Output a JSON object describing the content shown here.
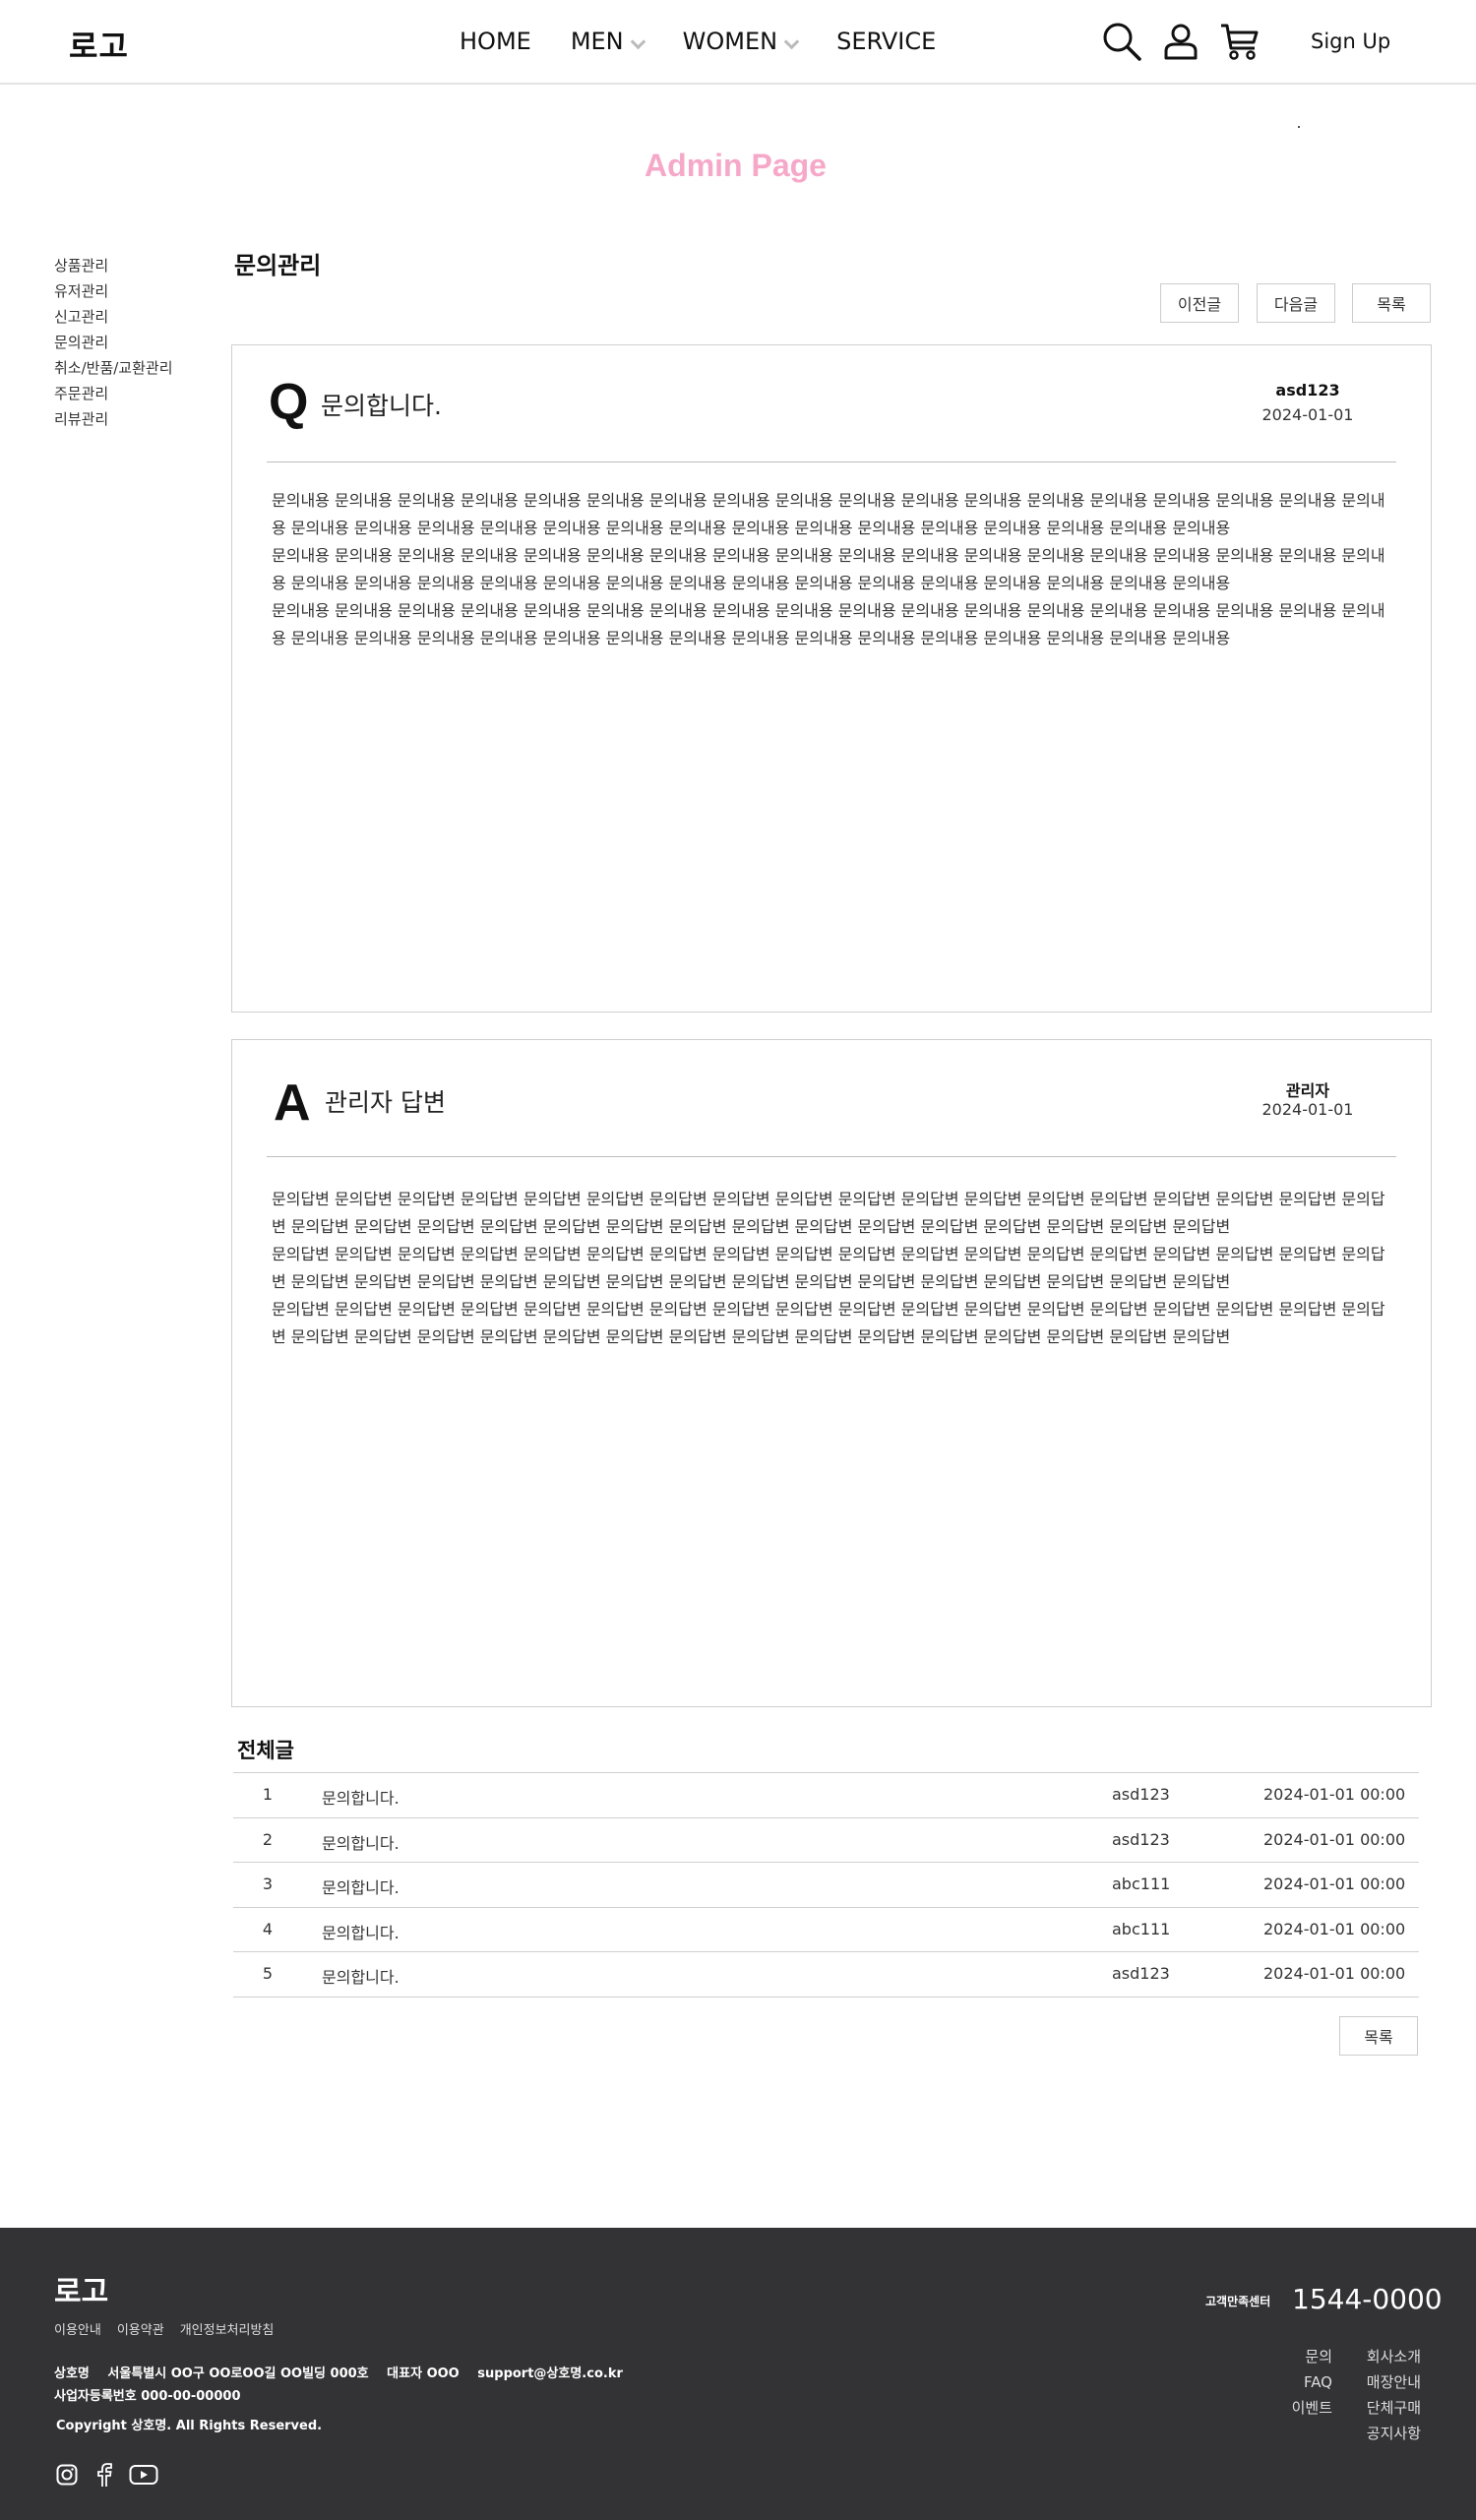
{
  "header": {
    "logo": "로고",
    "nav": [
      {
        "label": "HOME",
        "has_dropdown": false
      },
      {
        "label": "MEN",
        "has_dropdown": true
      },
      {
        "label": "WOMEN",
        "has_dropdown": true
      },
      {
        "label": "SERVICE",
        "has_dropdown": false
      }
    ],
    "icons": [
      "search-icon",
      "user-icon",
      "cart-icon"
    ],
    "signup": "Sign Up"
  },
  "page_title": "Admin Page",
  "sidebar": {
    "items": [
      "상품관리",
      "유저관리",
      "신고관리",
      "문의관리",
      "취소/반품/교환관리",
      "주문관리",
      "리뷰관리"
    ]
  },
  "main": {
    "section_title": "문의관리",
    "buttons": {
      "prev": "이전글",
      "next": "다음글",
      "list": "목록"
    },
    "question": {
      "mark": "Q",
      "title": "문의합니다.",
      "author": "asd123",
      "date": "2024-01-01",
      "paragraphs": [
        "문의내용 문의내용 문의내용 문의내용 문의내용 문의내용 문의내용 문의내용 문의내용 문의내용 문의내용 문의내용 문의내용 문의내용 문의내용 문의내용 문의내용 문의내용 문의내용 문의내용 문의내용 문의내용 문의내용 문의내용 문의내용 문의내용 문의내용 문의내용 문의내용 문의내용 문의내용 문의내용 문의내용",
        "문의내용 문의내용 문의내용 문의내용 문의내용 문의내용 문의내용 문의내용 문의내용 문의내용 문의내용 문의내용 문의내용 문의내용 문의내용 문의내용 문의내용 문의내용 문의내용 문의내용 문의내용 문의내용 문의내용 문의내용 문의내용 문의내용 문의내용 문의내용 문의내용 문의내용 문의내용 문의내용 문의내용",
        "문의내용 문의내용 문의내용 문의내용 문의내용 문의내용 문의내용 문의내용 문의내용 문의내용 문의내용 문의내용 문의내용 문의내용 문의내용 문의내용 문의내용 문의내용 문의내용 문의내용 문의내용 문의내용 문의내용 문의내용 문의내용 문의내용 문의내용 문의내용 문의내용 문의내용 문의내용 문의내용 문의내용"
      ]
    },
    "answer": {
      "mark": "A",
      "title": "관리자 답변",
      "author": "관리자",
      "date": "2024-01-01",
      "paragraphs": [
        "문의답변 문의답변 문의답변 문의답변 문의답변 문의답변 문의답변 문의답변 문의답변 문의답변 문의답변 문의답변 문의답변 문의답변 문의답변 문의답변 문의답변 문의답변 문의답변 문의답변 문의답변 문의답변 문의답변 문의답변 문의답변 문의답변 문의답변 문의답변 문의답변 문의답변 문의답변 문의답변 문의답변",
        "문의답변 문의답변 문의답변 문의답변 문의답변 문의답변 문의답변 문의답변 문의답변 문의답변 문의답변 문의답변 문의답변 문의답변 문의답변 문의답변 문의답변 문의답변 문의답변 문의답변 문의답변 문의답변 문의답변 문의답변 문의답변 문의답변 문의답변 문의답변 문의답변 문의답변 문의답변 문의답변 문의답변",
        "문의답변 문의답변 문의답변 문의답변 문의답변 문의답변 문의답변 문의답변 문의답변 문의답변 문의답변 문의답변 문의답변 문의답변 문의답변 문의답변 문의답변 문의답변 문의답변 문의답변 문의답변 문의답변 문의답변 문의답변 문의답변 문의답변 문의답변 문의답변 문의답변 문의답변 문의답변 문의답변 문의답변"
      ]
    },
    "list": {
      "title": "전체글",
      "rows": [
        {
          "num": "1",
          "title": "문의합니다.",
          "user": "asd123",
          "date": "2024-01-01 00:00"
        },
        {
          "num": "2",
          "title": "문의합니다.",
          "user": "asd123",
          "date": "2024-01-01 00:00"
        },
        {
          "num": "3",
          "title": "문의합니다.",
          "user": "abc111",
          "date": "2024-01-01 00:00"
        },
        {
          "num": "4",
          "title": "문의합니다.",
          "user": "abc111",
          "date": "2024-01-01 00:00"
        },
        {
          "num": "5",
          "title": "문의합니다.",
          "user": "asd123",
          "date": "2024-01-01 00:00"
        }
      ],
      "list_button": "목록"
    }
  },
  "footer": {
    "logo": "로고",
    "links": [
      "이용안내",
      "이용약관",
      "개인정보처리방침"
    ],
    "company": {
      "name": "상호명",
      "address": "서울특별시 OO구 OO로OO길 OO빌딩 000호",
      "ceo": "대표자 OOO",
      "email": "support@상호명.co.kr",
      "biz_no": "사업자등록번호 000-00-00000"
    },
    "copyright": "Copyright 상호명. All Rights Reserved.",
    "social_icons": [
      "instagram-icon",
      "facebook-icon",
      "youtube-icon"
    ],
    "cs_label": "고객만족센터",
    "cs_number": "1544-0000",
    "menu_left": [
      "문의",
      "FAQ",
      "이벤트"
    ],
    "menu_right": [
      "회사소개",
      "매장안내",
      "단체구매",
      "공지사항"
    ]
  }
}
